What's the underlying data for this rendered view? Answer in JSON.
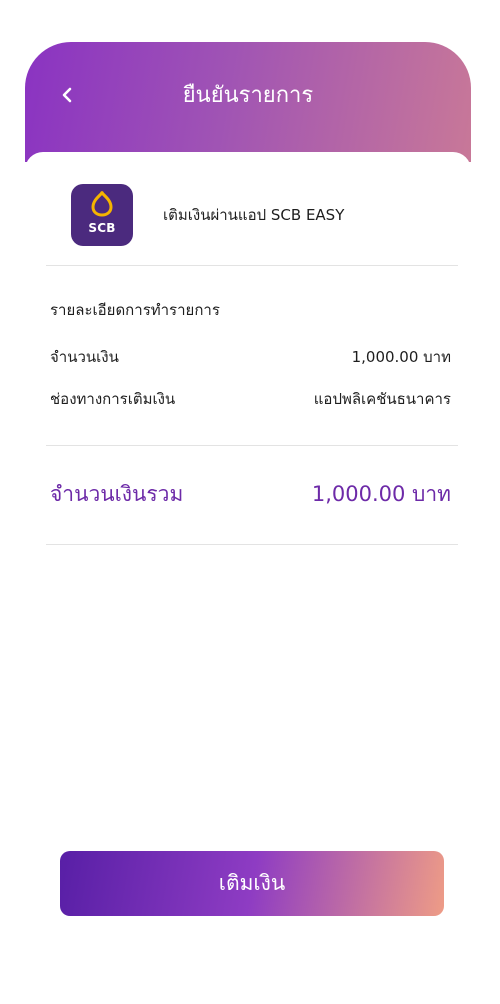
{
  "header": {
    "title": "ยืนยันรายการ",
    "back_icon": "chevron-left-icon"
  },
  "merchant": {
    "logo_text": "SCB",
    "name": "เติมเงินผ่านแอป SCB EASY",
    "logo_color": "#4b2a7e",
    "logo_accent": "#f5b400"
  },
  "details": {
    "section_title": "รายละเอียดการทำรายการ",
    "amount_label": "จำนวนเงิน",
    "amount_value": "1,000.00 บาท",
    "channel_label": "ช่องทางการเติมเงิน",
    "channel_value": "แอปพลิเคชันธนาคาร"
  },
  "total": {
    "label": "จำนวนเงินรวม",
    "value": "1,000.00 บาท",
    "color": "#6d2aa8"
  },
  "actions": {
    "topup_label": "เติมเงิน"
  },
  "colors": {
    "header_gradient_start": "#8a33c2",
    "header_gradient_end": "#c87898",
    "button_gradient_start": "#581fa6",
    "button_gradient_end": "#ee9c86"
  }
}
